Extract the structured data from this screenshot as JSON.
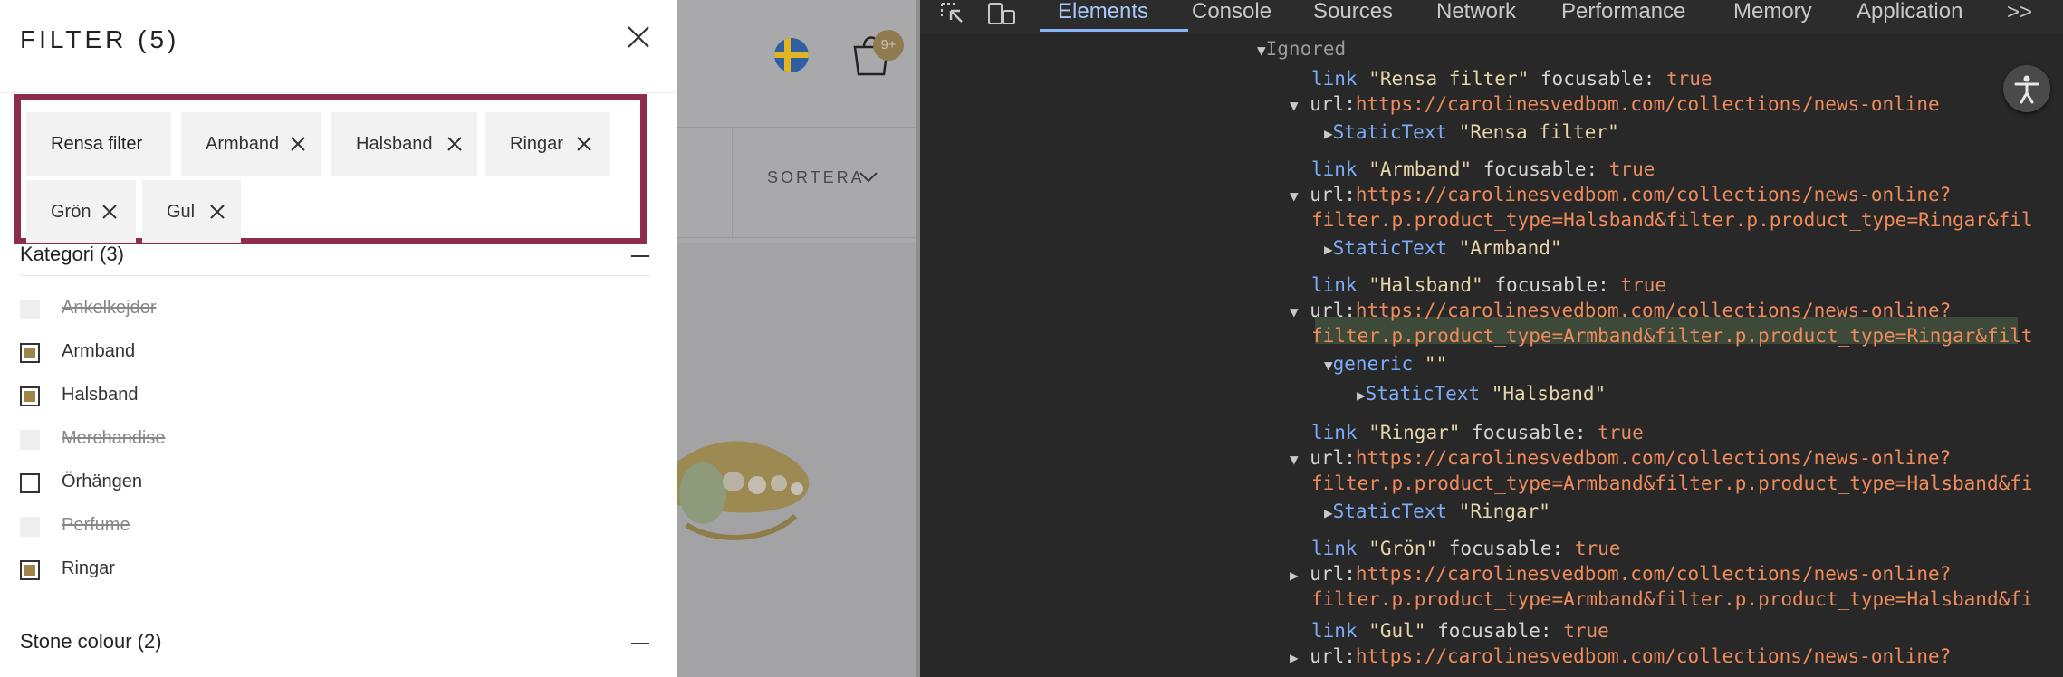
{
  "filter": {
    "title": "FILTER (5)",
    "active_chips": [
      {
        "label": "Rensa filter"
      },
      {
        "label": "Armband"
      },
      {
        "label": "Halsband"
      },
      {
        "label": "Ringar"
      },
      {
        "label": "Grön"
      },
      {
        "label": "Gul"
      }
    ],
    "category_section": {
      "title": "Kategori (3)",
      "options": [
        {
          "label": "Ankelkejdor",
          "state": "disabled"
        },
        {
          "label": "Armband",
          "state": "checked"
        },
        {
          "label": "Halsband",
          "state": "checked"
        },
        {
          "label": "Merchandise",
          "state": "disabled"
        },
        {
          "label": "Örhängen",
          "state": "unchecked"
        },
        {
          "label": "Perfume",
          "state": "disabled"
        },
        {
          "label": "Ringar",
          "state": "checked"
        }
      ]
    },
    "stone_section": {
      "title": "Stone colour (2)"
    }
  },
  "storefront": {
    "sort_label": "SORTERA",
    "cart_count": "9+",
    "flag_colors": {
      "blue": "#2f5fa0",
      "yellow": "#e0b424"
    }
  },
  "devtools": {
    "tabs": [
      "Elements",
      "Console",
      "Sources",
      "Network",
      "Performance",
      "Memory",
      "Application"
    ],
    "active_tab": "Elements",
    "more_label": ">>",
    "tree": {
      "ignored": "Ignored",
      "link_rensa": "link",
      "link_rensa_name": "\"Rensa filter\"",
      "focusable_label": "focusable:",
      "true_value": "true",
      "url_label": "url:",
      "url_base": "https://carolinesvedbom.com/collections/news-online",
      "url_query_start": "https://carolinesvedbom.com/collections/news-online?",
      "static_text": "StaticText",
      "rensa_text": "\"Rensa filter\"",
      "armband_name": "\"Armband\"",
      "armband_url2": "filter.p.product_type=Halsband&filter.p.product_type=Ringar&fil",
      "halsband_name": "\"Halsband\"",
      "halsband_url2": "filter.p.product_type=Armband&filter.p.product_type=Ringar&filt",
      "generic_role": "generic",
      "generic_value": "\"\"",
      "ringar_name": "\"Ringar\"",
      "ringar_url2": "filter.p.product_type=Armband&filter.p.product_type=Halsband&fi",
      "gron_name": "\"Grön\"",
      "gron_url2": "filter.p.product_type=Armband&filter.p.product_type=Halsband&fi",
      "gul_name": "\"Gul\""
    },
    "accent_color": "#8ab4f8",
    "highlight_border_color": "#8d2c4d"
  }
}
